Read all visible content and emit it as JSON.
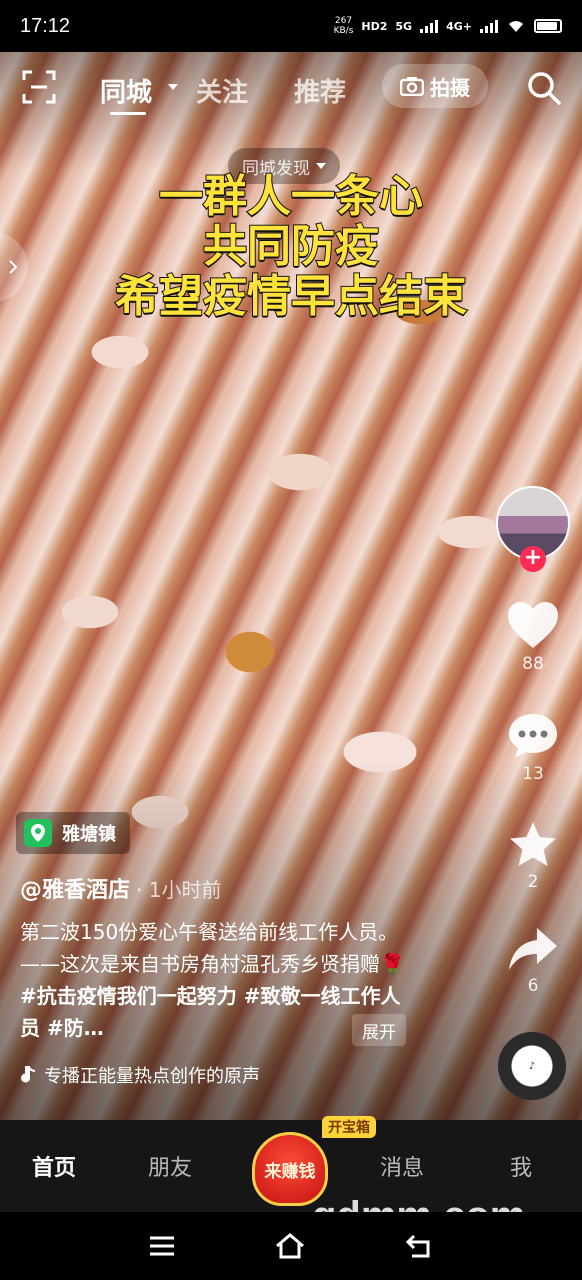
{
  "status": {
    "time": "17:12",
    "speed_value": "267",
    "speed_unit": "KB/s",
    "hd": "HD2",
    "net_5g": "5G",
    "net_4g": "4G+"
  },
  "top_nav": {
    "tabs": [
      "同城",
      "关注",
      "推荐"
    ],
    "active_tab": "同城",
    "shoot_label": "拍摄"
  },
  "discover_label": "同城发现",
  "caption_lines": [
    "一群人一条心",
    "共同防疫",
    "希望疫情早点结束"
  ],
  "actions": {
    "likes": "88",
    "comments": "13",
    "favorites": "2",
    "shares": "6"
  },
  "location": "雅塘镇",
  "author": "@雅香酒店",
  "post_time": "· 1小时前",
  "description": {
    "text": "第二波150份爱心午餐送给前线工作人员。——这次是来自书房角村温孔秀乡贤捐赠🌹",
    "tags": "#抗击疫情我们一起努力 #致敬一线工作人员 #防…"
  },
  "expand_label": "展开",
  "music": "专播正能量热点创作的原声",
  "bottom_tabs": {
    "home": "首页",
    "friends": "朋友",
    "earn": "来赚钱",
    "treasure": "开宝箱",
    "messages": "消息",
    "me": "我"
  },
  "watermark": "gdmm.com",
  "colors": {
    "caption_yellow": "#ffe23a",
    "follow_red": "#fe2c55",
    "location_green": "#21c25e"
  }
}
